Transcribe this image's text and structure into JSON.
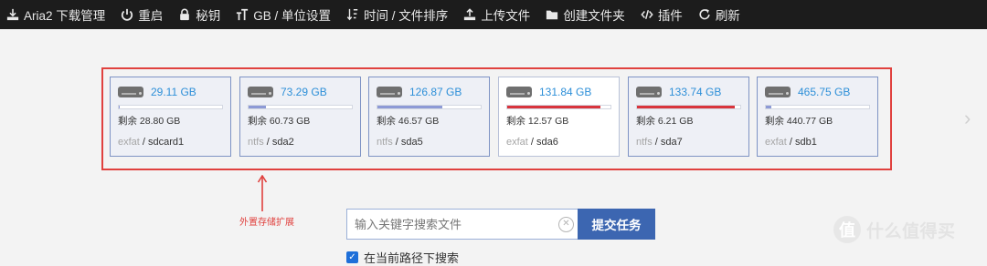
{
  "topnav": {
    "items": [
      {
        "icon": "download-icon",
        "label": "Aria2 下载管理"
      },
      {
        "icon": "power-icon",
        "label": "重启"
      },
      {
        "icon": "lock-icon",
        "label": "秘钥"
      },
      {
        "icon": "text-size-icon",
        "label": "GB / 单位设置"
      },
      {
        "icon": "sort-icon",
        "label": "时间 / 文件排序"
      },
      {
        "icon": "upload-icon",
        "label": "上传文件"
      },
      {
        "icon": "folder-icon",
        "label": "创建文件夹"
      },
      {
        "icon": "code-icon",
        "label": "插件"
      },
      {
        "icon": "refresh-icon",
        "label": "刷新"
      }
    ]
  },
  "disks": [
    {
      "size": "29.11 GB",
      "free": "剩余 28.80 GB",
      "fstype": "exfat",
      "device": "/ sdcard1",
      "used_fraction": 0.01
    },
    {
      "size": "73.29 GB",
      "free": "剩余 60.73 GB",
      "fstype": "ntfs",
      "device": "/ sda2",
      "used_fraction": 0.17
    },
    {
      "size": "126.87 GB",
      "free": "剩余 46.57 GB",
      "fstype": "ntfs",
      "device": "/ sda5",
      "used_fraction": 0.63
    },
    {
      "size": "131.84 GB",
      "free": "剩余 12.57 GB",
      "fstype": "exfat",
      "device": "/ sda6",
      "used_fraction": 0.9
    },
    {
      "size": "133.74 GB",
      "free": "剩余 6.21 GB",
      "fstype": "ntfs",
      "device": "/ sda7",
      "used_fraction": 0.95
    },
    {
      "size": "465.75 GB",
      "free": "剩余 440.77 GB",
      "fstype": "exfat",
      "device": "/ sdb1",
      "used_fraction": 0.05
    }
  ],
  "annotation": "外置存储扩展",
  "search": {
    "placeholder": "输入关键字搜索文件",
    "value": "",
    "clear_icon": "clear-icon"
  },
  "submit_label": "提交任务",
  "checkbox_label": "在当前路径下搜索",
  "watermark": {
    "badge": "值",
    "text": "什么值得买"
  },
  "colors": {
    "accent": "#3c66b1",
    "danger": "#d9343c",
    "usage": "#8d9ad6",
    "size_text": "#2d8fd8",
    "annotation": "#e0413e"
  }
}
